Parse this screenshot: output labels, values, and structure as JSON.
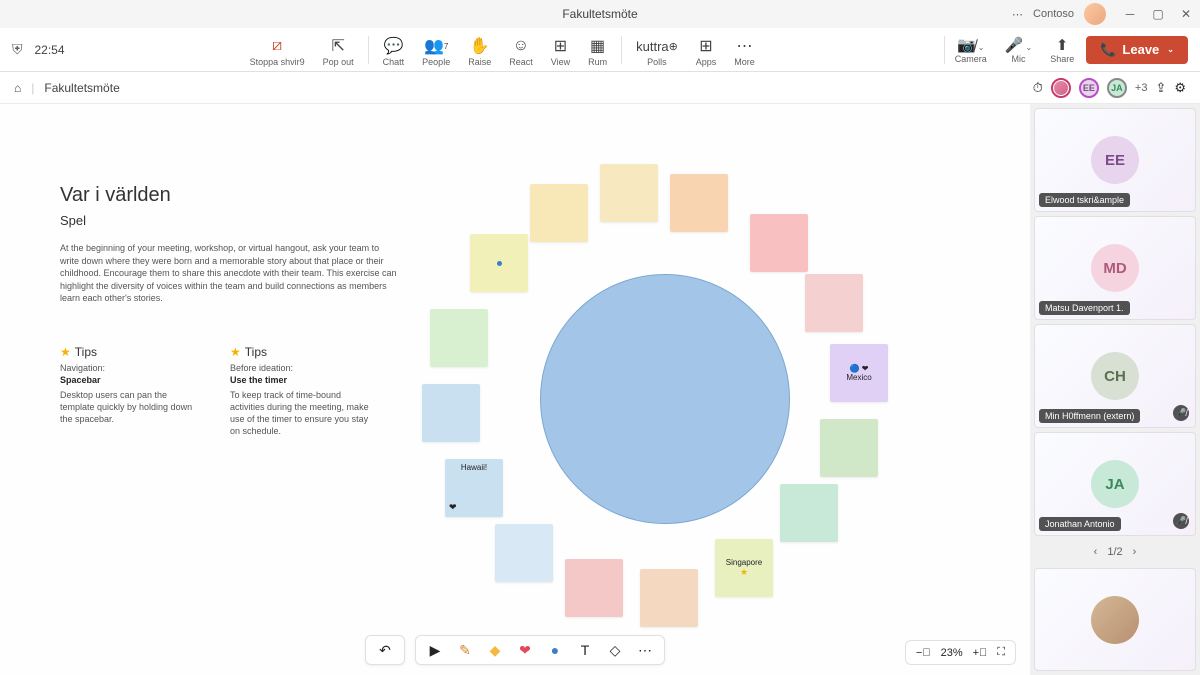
{
  "window": {
    "title": "Fakultetsmöte",
    "org": "Contoso"
  },
  "toolbar": {
    "time": "22:54",
    "stop_share": "Stoppa shvir9",
    "pop_out": "Pop out",
    "chat": "Chatt",
    "people": "People",
    "people_count": "7",
    "raise": "Raise",
    "react": "React",
    "view": "View",
    "rooms": "Rum",
    "polls": "Polls",
    "polls_brand": "kuttra",
    "apps": "Apps",
    "more": "More",
    "camera": "Camera",
    "mic": "Mic",
    "share": "Share",
    "leave": "Leave"
  },
  "subbar": {
    "crumb": "Fakultetsmöte",
    "overflow": "+3"
  },
  "whiteboard": {
    "title": "Var i världen",
    "subtitle": "Spel",
    "description": "At the beginning of your meeting, workshop, or virtual hangout, ask your team to write down where they were born and a memorable story about that place or their childhood. Encourage them to share this anecdote with their team. This exercise can highlight the diversity of voices within the team and build connections as members learn each other's stories.",
    "tips": [
      {
        "title": "Tips",
        "sub": "Navigation:",
        "bold": "Spacebar",
        "body": "Desktop users can pan the template quickly by holding down the spacebar."
      },
      {
        "title": "Tips",
        "sub": "Before ideation:",
        "bold": "Use the timer",
        "body": "To keep track of time-bound activities during the meeting, make use of the timer to ensure you stay on schedule."
      }
    ],
    "notes": {
      "hawaii": "Hawaii!",
      "mexico": "Mexico",
      "singapore": "Singapore"
    },
    "zoom": "23%"
  },
  "participants": {
    "list": [
      {
        "initials": "EE",
        "name": "Elwood tskri&ample",
        "bg": "#e8d4ed",
        "fg": "#7a4d8a",
        "muted": false
      },
      {
        "initials": "MD",
        "name": "Matsu Davenport 1.",
        "bg": "#f5d4e0",
        "fg": "#b05a7a",
        "muted": false
      },
      {
        "initials": "CH",
        "name": "Min H0ffmenn (extern)",
        "bg": "#d8e0d4",
        "fg": "#5a7050",
        "muted": true
      },
      {
        "initials": "JA",
        "name": "Jonathan Antonio",
        "bg": "#c8e8d8",
        "fg": "#3a8a5a",
        "muted": true
      }
    ],
    "page": "1/2"
  }
}
